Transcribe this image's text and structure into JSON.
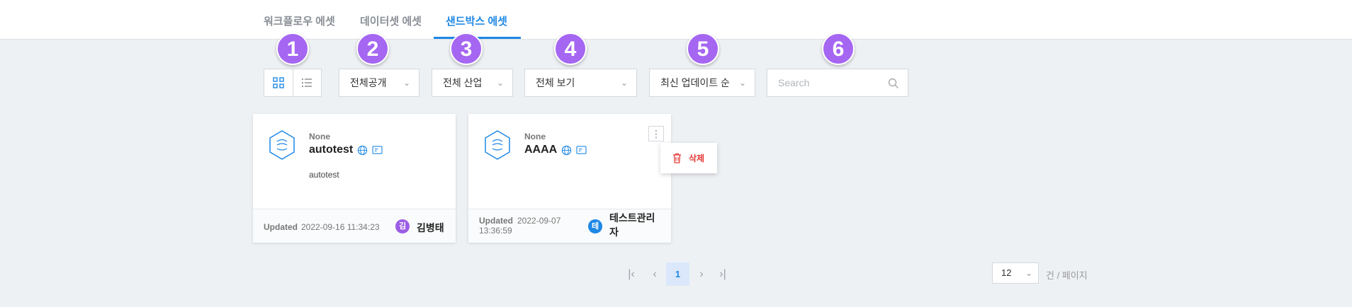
{
  "tabs": [
    {
      "label": "워크플로우 에셋",
      "active": false
    },
    {
      "label": "데이터셋 에셋",
      "active": false
    },
    {
      "label": "샌드박스 에셋",
      "active": true
    }
  ],
  "badges": [
    "1",
    "2",
    "3",
    "4",
    "5",
    "6"
  ],
  "filters": {
    "visibility": "전체공개",
    "industry": "전체 산업",
    "view": "전체 보기",
    "sort": "최신 업데이트 순"
  },
  "search": {
    "placeholder": "Search",
    "value": ""
  },
  "cards": [
    {
      "category": "None",
      "title": "autotest",
      "description": "autotest",
      "updated_label": "Updated",
      "updated_date": "2022-09-16 11:34:23",
      "avatar_initial": "김",
      "avatar_color": "#9b5de5",
      "user": "김병태"
    },
    {
      "category": "None",
      "title": "AAAA",
      "description": "",
      "updated_label": "Updated",
      "updated_date_line1": "2022-09-07",
      "updated_date_line2": "13:36:59",
      "avatar_initial": "테",
      "avatar_color": "#1e88e5",
      "user_line1": "테스트관리",
      "user_line2": "자"
    }
  ],
  "card_menu": {
    "delete_label": "삭제"
  },
  "pagination": {
    "current_page": "1"
  },
  "page_size": {
    "value": "12",
    "suffix": "건 / 페이지"
  },
  "colors": {
    "accent": "#1e88e5",
    "badge": "#a566f2",
    "danger": "#e53935"
  },
  "icons": [
    "grid-view-icon",
    "list-view-icon",
    "chevron-down-icon",
    "search-icon",
    "sandbox-hex-icon",
    "globe-icon",
    "card-icon",
    "kebab-menu-icon",
    "trash-icon",
    "first-page-icon",
    "prev-page-icon",
    "next-page-icon",
    "last-page-icon"
  ]
}
